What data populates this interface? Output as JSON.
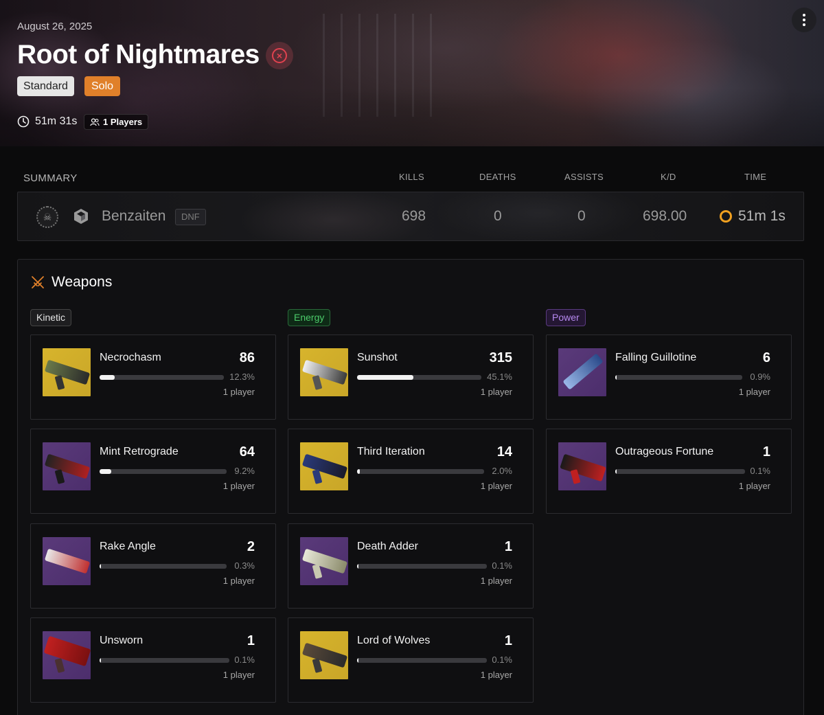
{
  "hero": {
    "date": "August 26, 2025",
    "title": "Root of Nightmares",
    "status_icon": "failed-circle-x-icon",
    "badges": {
      "mode": "Standard",
      "type": "Solo"
    },
    "duration": "51m 31s",
    "players": "1 Players"
  },
  "summary": {
    "title": "SUMMARY",
    "columns": {
      "kills": "KILLS",
      "deaths": "DEATHS",
      "assists": "ASSISTS",
      "kd": "K/D",
      "time": "TIME"
    },
    "row": {
      "name": "Benzaiten",
      "badge": "DNF",
      "kills": "698",
      "deaths": "0",
      "assists": "0",
      "kd": "698.00",
      "time": "51m 1s",
      "time_color": "#f0a020"
    }
  },
  "weapons": {
    "title": "Weapons",
    "slots": {
      "kinetic": "Kinetic",
      "energy": "Energy",
      "power": "Power"
    },
    "kinetic": [
      {
        "name": "Necrochasm",
        "kills": "86",
        "pct": "12.3%",
        "pct_value": 0.123,
        "players": "1 player"
      },
      {
        "name": "Mint Retrograde",
        "kills": "64",
        "pct": "9.2%",
        "pct_value": 0.092,
        "players": "1 player"
      },
      {
        "name": "Rake Angle",
        "kills": "2",
        "pct": "0.3%",
        "pct_value": 0.003,
        "players": "1 player"
      },
      {
        "name": "Unsworn",
        "kills": "1",
        "pct": "0.1%",
        "pct_value": 0.001,
        "players": "1 player"
      }
    ],
    "energy": [
      {
        "name": "Sunshot",
        "kills": "315",
        "pct": "45.1%",
        "pct_value": 0.451,
        "players": "1 player"
      },
      {
        "name": "Third Iteration",
        "kills": "14",
        "pct": "2.0%",
        "pct_value": 0.02,
        "players": "1 player"
      },
      {
        "name": "Death Adder",
        "kills": "1",
        "pct": "0.1%",
        "pct_value": 0.001,
        "players": "1 player"
      },
      {
        "name": "Lord of Wolves",
        "kills": "1",
        "pct": "0.1%",
        "pct_value": 0.001,
        "players": "1 player"
      }
    ],
    "power": [
      {
        "name": "Falling Guillotine",
        "kills": "6",
        "pct": "0.9%",
        "pct_value": 0.009,
        "players": "1 player"
      },
      {
        "name": "Outrageous Fortune",
        "kills": "1",
        "pct": "0.1%",
        "pct_value": 0.001,
        "players": "1 player"
      }
    ]
  },
  "colors": {
    "accent_orange": "#e0802a",
    "energy_green": "#4ccb6a",
    "power_purple": "#b789f0",
    "status_red": "#e0424f"
  }
}
